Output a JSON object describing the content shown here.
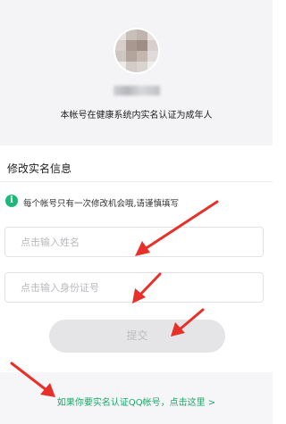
{
  "profile": {
    "verify_status": "本帐号在健康系统内实名认证为成年人"
  },
  "form": {
    "section_title": "修改实名信息",
    "tip_icon": "i",
    "tip_text": "每个帐号只有一次修改机会哦,请谨慎填写",
    "name_placeholder": "点击输入姓名",
    "id_placeholder": "点击输入身份证号",
    "submit_label": "提交"
  },
  "footer": {
    "qq_link": "如果你要实名认证QQ帐号，点击这里 >"
  },
  "colors": {
    "accent": "#1cb877",
    "link": "#19a866",
    "arrow": "#e8302a"
  }
}
